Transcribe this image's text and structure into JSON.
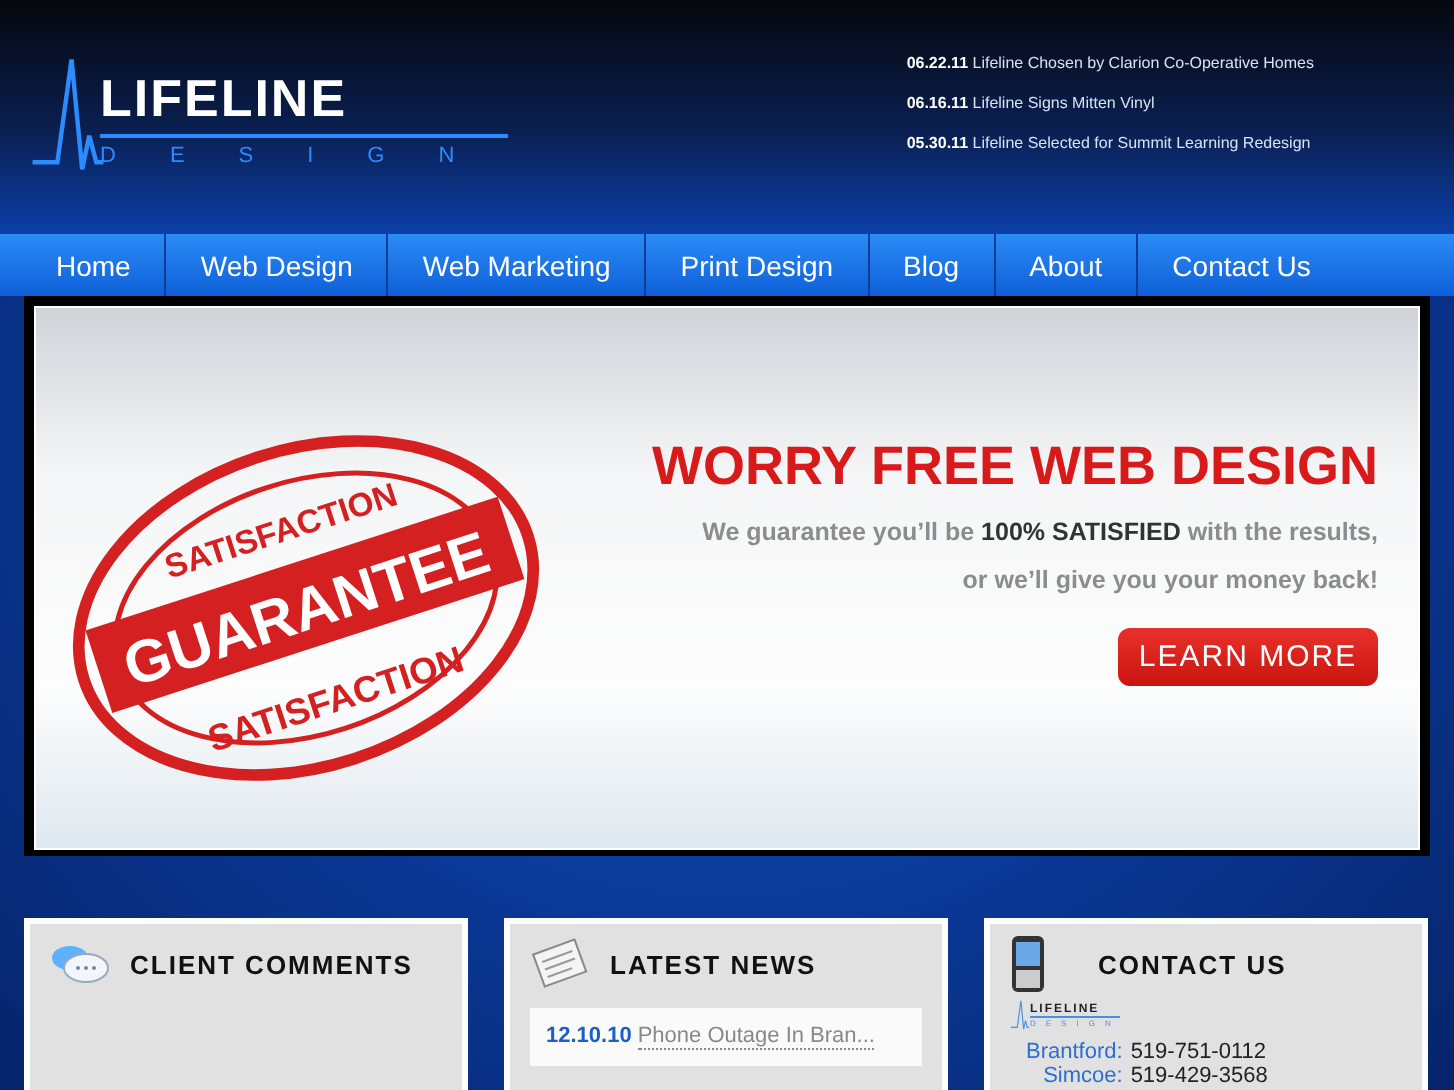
{
  "logo": {
    "name": "LIFELINE",
    "tagline": "DESIGN"
  },
  "headlines": [
    {
      "date": "06.22.11",
      "text": "Lifeline Chosen by Clarion Co-Operative Homes"
    },
    {
      "date": "06.16.11",
      "text": "Lifeline Signs Mitten Vinyl"
    },
    {
      "date": "05.30.11",
      "text": "Lifeline Selected for Summit Learning Redesign"
    }
  ],
  "nav": [
    "Home",
    "Web Design",
    "Web Marketing",
    "Print Design",
    "Blog",
    "About",
    "Contact Us"
  ],
  "banner": {
    "stamp_top": "SATISFACTION",
    "stamp_middle": "GUARANTEE",
    "stamp_bottom": "SATISFACTION",
    "title": "WORRY FREE WEB DESIGN",
    "line1": "We guarantee you’ll be **100% SATISFIED** with the results,",
    "line2": "or we’ll give you your money back!",
    "button": "LEARN MORE"
  },
  "cards": [
    {
      "kind": "comments",
      "title": "CLIENT COMMENTS"
    },
    {
      "kind": "news",
      "title": "LATEST NEWS",
      "items": [
        {
          "date": "12.10.10",
          "text": "Phone Outage In Bran..."
        }
      ]
    },
    {
      "kind": "contact",
      "title": "CONTACT US",
      "logo_name": "LIFELINE",
      "logo_tagline": "DESIGN",
      "phones": [
        {
          "place": "Brantford:",
          "number": "519-751-0112"
        },
        {
          "place": "Simcoe:",
          "number": "519-429-3568"
        }
      ]
    }
  ]
}
